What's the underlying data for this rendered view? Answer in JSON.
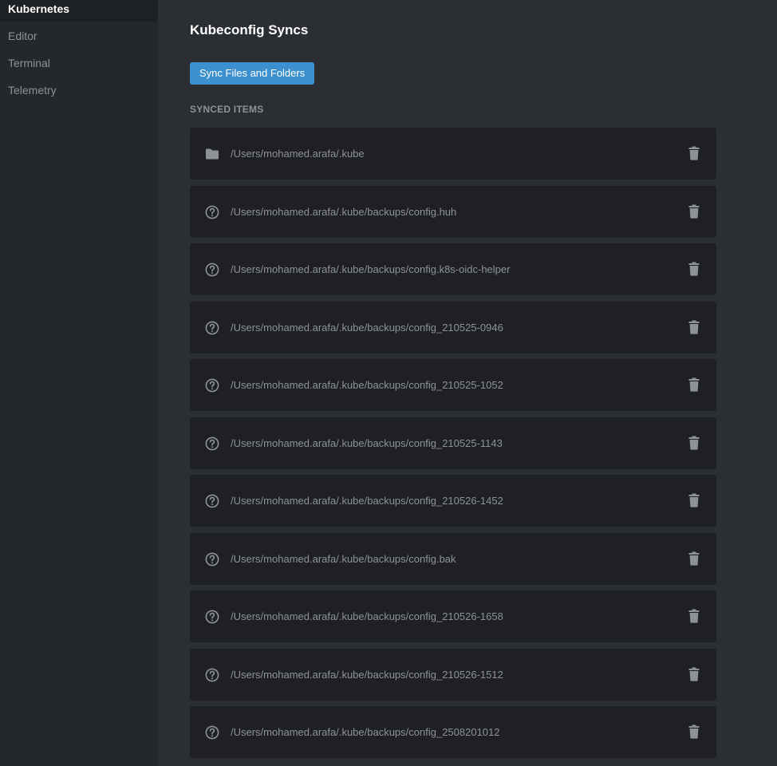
{
  "sidebar": {
    "items": [
      {
        "label": "Kubernetes",
        "active": true
      },
      {
        "label": "Editor",
        "active": false
      },
      {
        "label": "Terminal",
        "active": false
      },
      {
        "label": "Telemetry",
        "active": false
      }
    ]
  },
  "main": {
    "title": "Kubeconfig Syncs",
    "sync_button_label": "Sync Files and Folders",
    "section_label": "SYNCED ITEMS",
    "items": [
      {
        "icon": "folder-icon",
        "path": "/Users/mohamed.arafa/.kube"
      },
      {
        "icon": "help-circle-icon",
        "path": "/Users/mohamed.arafa/.kube/backups/config.huh"
      },
      {
        "icon": "help-circle-icon",
        "path": "/Users/mohamed.arafa/.kube/backups/config.k8s-oidc-helper"
      },
      {
        "icon": "help-circle-icon",
        "path": "/Users/mohamed.arafa/.kube/backups/config_210525-0946"
      },
      {
        "icon": "help-circle-icon",
        "path": "/Users/mohamed.arafa/.kube/backups/config_210525-1052"
      },
      {
        "icon": "help-circle-icon",
        "path": "/Users/mohamed.arafa/.kube/backups/config_210525-1143"
      },
      {
        "icon": "help-circle-icon",
        "path": "/Users/mohamed.arafa/.kube/backups/config_210526-1452"
      },
      {
        "icon": "help-circle-icon",
        "path": "/Users/mohamed.arafa/.kube/backups/config.bak"
      },
      {
        "icon": "help-circle-icon",
        "path": "/Users/mohamed.arafa/.kube/backups/config_210526-1658"
      },
      {
        "icon": "help-circle-icon",
        "path": "/Users/mohamed.arafa/.kube/backups/config_210526-1512"
      },
      {
        "icon": "help-circle-icon",
        "path": "/Users/mohamed.arafa/.kube/backups/config_2508201012"
      }
    ]
  },
  "colors": {
    "background": "#2b2e33",
    "sidebar": "#24272b",
    "row": "#1e2024",
    "accent": "#3d90ce",
    "muted_text": "#8e9297",
    "icon": "#8e9297"
  }
}
